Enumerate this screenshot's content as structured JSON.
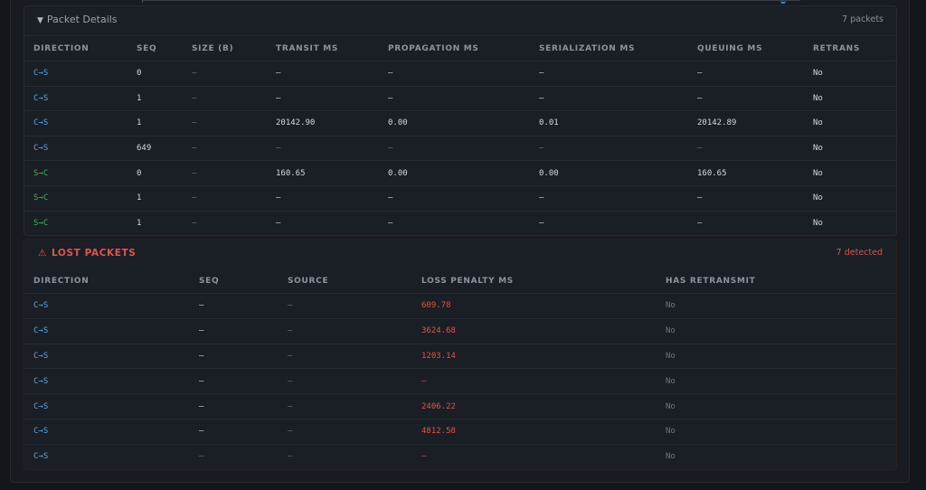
{
  "details": {
    "title": "Packet Details",
    "count": "7 packets",
    "columns": [
      "DIRECTION",
      "SEQ",
      "SIZE (B)",
      "TRANSIT MS",
      "PROPAGATION MS",
      "SERIALIZATION MS",
      "QUEUING MS",
      "RETRANS"
    ],
    "rows": [
      [
        "C→S",
        "0",
        "—",
        "—",
        "—",
        "—",
        "—",
        "No"
      ],
      [
        "C→S",
        "1",
        "—",
        "—",
        "—",
        "—",
        "—",
        "No"
      ],
      [
        "C→S",
        "1",
        "—",
        "20142.90",
        "0.00",
        "0.01",
        "20142.89",
        "No"
      ],
      [
        "C→S",
        "649",
        "—",
        "—",
        "—",
        "—",
        "—",
        "No"
      ],
      [
        "S→C",
        "0",
        "—",
        "160.65",
        "0.00",
        "0.00",
        "160.65",
        "No"
      ],
      [
        "S→C",
        "1",
        "—",
        "—",
        "—",
        "—",
        "—",
        "No"
      ],
      [
        "S→C",
        "1",
        "—",
        "—",
        "—",
        "—",
        "—",
        "No"
      ]
    ]
  },
  "lost": {
    "title": "LOST PACKETS",
    "count": "7 detected",
    "columns": [
      "DIRECTION",
      "SEQ",
      "SOURCE",
      "LOSS PENALTY MS",
      "HAS RETRANSMIT"
    ],
    "rows": [
      [
        "C→S",
        "—",
        "—",
        "609.78",
        "No"
      ],
      [
        "C→S",
        "—",
        "—",
        "3624.68",
        "No"
      ],
      [
        "C→S",
        "—",
        "—",
        "1203.14",
        "No"
      ],
      [
        "C→S",
        "—",
        "—",
        "—",
        "No"
      ],
      [
        "C→S",
        "—",
        "—",
        "2406.22",
        "No"
      ],
      [
        "C→S",
        "—",
        "—",
        "4812.58",
        "No"
      ],
      [
        "C→S",
        "—",
        "—",
        "—",
        "No"
      ]
    ]
  },
  "colors": {
    "client_to_server": "#5aa9e6",
    "server_to_client": "#3fb950",
    "loss": "#e5534b"
  },
  "icons": {
    "collapse": "caret-down-icon",
    "lost": "warning-icon"
  }
}
